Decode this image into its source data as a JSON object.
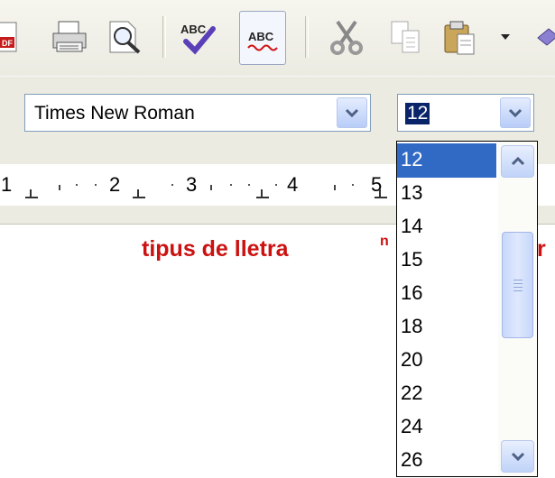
{
  "toolbar": {
    "icons": [
      "export-pdf-icon",
      "print-icon",
      "page-preview-icon",
      "spellcheck-icon",
      "autospellcheck-icon",
      "cut-icon",
      "copy-icon",
      "paste-icon",
      "paste-dropdown-icon",
      "paint-icon"
    ]
  },
  "formatting": {
    "font_name": "Times New Roman",
    "font_size": "12"
  },
  "ruler": {
    "labels": [
      "1",
      "2",
      "3",
      "4",
      "5"
    ]
  },
  "document": {
    "visible_text": "tipus de lletra",
    "fragment_n": "n",
    "fragment_r": "r"
  },
  "size_dropdown": {
    "options": [
      "12",
      "13",
      "14",
      "15",
      "16",
      "18",
      "20",
      "22",
      "24",
      "26"
    ],
    "selected": "12"
  },
  "colors": {
    "selection": "#316ac5",
    "doc_text": "#cc1111",
    "toolbar_bg": "#ecebe2"
  }
}
